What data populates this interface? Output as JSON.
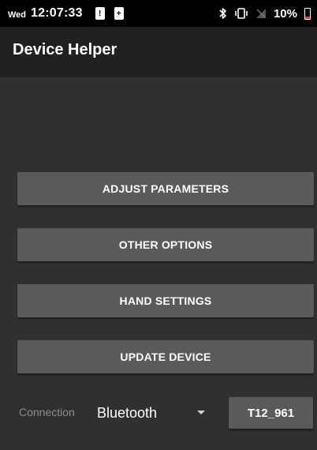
{
  "status_bar": {
    "day": "Wed",
    "time": "12:07:33",
    "notification_icons": [
      "alert-notification-icon",
      "battery-plus-notification-icon"
    ],
    "notif_glyphs": [
      "!",
      "+"
    ],
    "right_icons": [
      "bluetooth-icon",
      "vibrate-icon",
      "no-signal-icon"
    ],
    "battery_percent": "10%",
    "battery_level": 0.1,
    "battery_color": "#e53935"
  },
  "app_bar": {
    "title": "Device Helper"
  },
  "actions": [
    {
      "id": "adjust-parameters-button",
      "label": "ADJUST PARAMETERS"
    },
    {
      "id": "other-options-button",
      "label": "OTHER OPTIONS"
    },
    {
      "id": "hand-settings-button",
      "label": "HAND SETTINGS"
    },
    {
      "id": "update-device-button",
      "label": "UPDATE DEVICE"
    }
  ],
  "connection": {
    "label": "Connection",
    "selected": "Bluetooth",
    "device_label": "T12_961"
  },
  "colors": {
    "background": "#303030",
    "status_bar": "#000000",
    "app_bar": "#212121",
    "button": "#5a5a5a",
    "text": "#ffffff",
    "muted_text": "#8e8e8e"
  }
}
